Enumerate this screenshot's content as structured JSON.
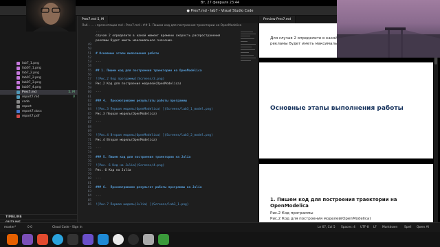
{
  "system": {
    "clock": "Вт, 27 февраля  23:44"
  },
  "window": {
    "title": "● Pres7.md - lab7 - Visual Studio Code"
  },
  "explorer": {
    "files": [
      {
        "name": "lab7_1.png",
        "status": ""
      },
      {
        "name": "lab07_1.png",
        "status": ""
      },
      {
        "name": "lab7_2.png",
        "status": ""
      },
      {
        "name": "lab07_2.png",
        "status": ""
      },
      {
        "name": "lab07_3.png",
        "status": ""
      },
      {
        "name": "lab07_4.png",
        "status": ""
      },
      {
        "name": "Pres7.md",
        "status": "5, M"
      },
      {
        "name": "report7.md",
        "status": "U"
      },
      {
        "name": "code",
        "status": ""
      },
      {
        "name": "report",
        "status": ""
      },
      {
        "name": "report7.docx",
        "status": ""
      },
      {
        "name": "report7.pdf",
        "status": ""
      }
    ],
    "outline_label": "OUTLINE",
    "timeline_label": "TIMELINE"
  },
  "editor": {
    "tab_label": "Pres7.md  5, M",
    "breadcrumbs": "Лаб › … › презентации md › Pres7.md › ## 1. Пишем код для построения траектории на OpenModelica",
    "lines": [
      {
        "n": "",
        "text": "...",
        "kind": "d"
      },
      {
        "n": "",
        "text": "случае 2 определите в какой момент времени скорость распространения",
        "kind": ""
      },
      {
        "n": "",
        "text": "рекламы будет иметь максимальное значение.",
        "kind": ""
      },
      {
        "n": "49",
        "text": "",
        "kind": ""
      },
      {
        "n": "50",
        "text": "",
        "kind": ""
      },
      {
        "n": "51",
        "text": "# Основные этапы выполнения работы",
        "kind": "h"
      },
      {
        "n": "52",
        "text": "",
        "kind": ""
      },
      {
        "n": "53",
        "text": "---",
        "kind": "d"
      },
      {
        "n": "54",
        "text": "",
        "kind": ""
      },
      {
        "n": "55",
        "text": "## 1. Пишем код для построения траектории на OpenModelica",
        "kind": "h"
      },
      {
        "n": "56",
        "text": "",
        "kind": ""
      },
      {
        "n": "57",
        "text": "![Рис.2 Код программы](Screens/3.png)",
        "kind": "r"
      },
      {
        "n": "58",
        "text": "Рис.2 Код для построения моделей(OpenModelica)",
        "kind": ""
      },
      {
        "n": "59",
        "text": "",
        "kind": ""
      },
      {
        "n": "60",
        "text": "---",
        "kind": "d"
      },
      {
        "n": "61",
        "text": "",
        "kind": ""
      },
      {
        "n": "62",
        "text": "### 4.  Просмотриваем результаты работы программы",
        "kind": "h"
      },
      {
        "n": "63",
        "text": "",
        "kind": ""
      },
      {
        "n": "64",
        "text": "![Рис.3 Первая модель(OpenModelica) ](Screens/lab3_1_model.png)",
        "kind": "r"
      },
      {
        "n": "65",
        "text": "Рис.3 Первая модель(OpenModelica)",
        "kind": ""
      },
      {
        "n": "66",
        "text": "",
        "kind": ""
      },
      {
        "n": "67",
        "text": "---",
        "kind": "d"
      },
      {
        "n": "68",
        "text": "",
        "kind": ""
      },
      {
        "n": "69",
        "text": "",
        "kind": ""
      },
      {
        "n": "70",
        "text": "![Рис.4 Вторая модель(OpenModelica) ](Screens/lab3_2_model.png)",
        "kind": "r"
      },
      {
        "n": "71",
        "text": "Рис.4 Вторая модель(OpenModelica)",
        "kind": ""
      },
      {
        "n": "72",
        "text": "",
        "kind": ""
      },
      {
        "n": "73",
        "text": "---",
        "kind": "d"
      },
      {
        "n": "74",
        "text": "",
        "kind": ""
      },
      {
        "n": "75",
        "text": "### 5. Пишем код для построения траектории на Julia",
        "kind": "h"
      },
      {
        "n": "76",
        "text": "",
        "kind": ""
      },
      {
        "n": "77",
        "text": "![Рис. 6 Код на Julia](Screens/4.png)",
        "kind": "r"
      },
      {
        "n": "78",
        "text": "Рис. 6 Код на Julia",
        "kind": ""
      },
      {
        "n": "79",
        "text": "",
        "kind": ""
      },
      {
        "n": "80",
        "text": "---",
        "kind": "d"
      },
      {
        "n": "81",
        "text": "",
        "kind": ""
      },
      {
        "n": "82",
        "text": "### 6.  Просматриваем результат работы программы на Julia",
        "kind": "h"
      },
      {
        "n": "83",
        "text": "",
        "kind": ""
      },
      {
        "n": "84",
        "text": "---",
        "kind": "d"
      },
      {
        "n": "85",
        "text": "",
        "kind": ""
      },
      {
        "n": "86",
        "text": "![Рис.7 Первая модель(Julia) ](Screens/lab3_1.png)",
        "kind": "r"
      }
    ]
  },
  "preview": {
    "tab_label": "Preview Pres7.md",
    "slide1_text": "Для случая 2 определите в какой момент времени скорость распространения рекламы будет иметь максимальное значение.",
    "slide2_heading": "Основные этапы выполнения работы",
    "slide3_heading": "1. Пишем код для построения траектории на OpenModelica",
    "slide3_image_alt": "Рис.2 Код программы",
    "slide3_caption": "Рис.2 Код для построения моделей(OpenModelica)"
  },
  "statusbar": {
    "branch": "master*",
    "problems": "0  0",
    "cloud": "Cloud Code - Sign in",
    "position": "Ln 67, Col 5",
    "spaces": "Spaces: 4",
    "encoding": "UTF-8",
    "eol": "LF",
    "language": "Markdown",
    "spell": "Spell",
    "ai": "Qwen AI"
  },
  "dock": {
    "apps": [
      "firefox",
      "files",
      "appimage",
      "telegram",
      "terminal",
      "obsidian",
      "vscode",
      "chrome",
      "obs",
      "calculator",
      "trash"
    ]
  }
}
